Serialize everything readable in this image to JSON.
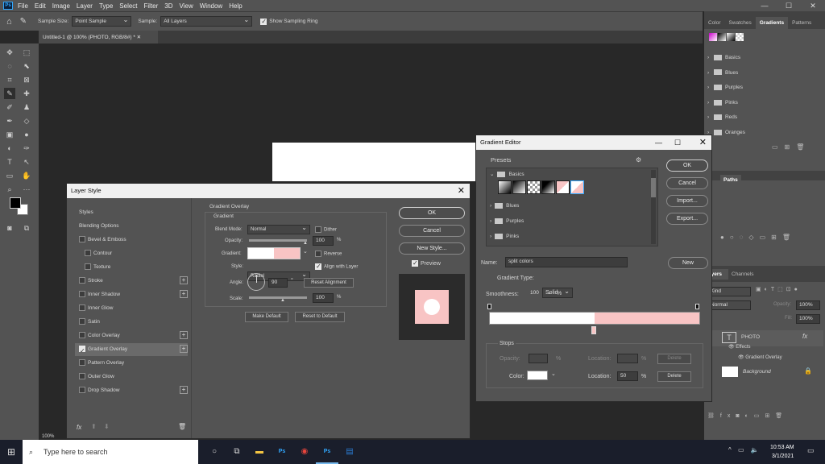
{
  "menu": {
    "items": [
      "File",
      "Edit",
      "Image",
      "Layer",
      "Type",
      "Select",
      "Filter",
      "3D",
      "View",
      "Window",
      "Help"
    ],
    "ps": "Ps"
  },
  "options": {
    "sample_size_label": "Sample Size:",
    "sample_size_value": "Point Sample",
    "sample_label": "Sample:",
    "sample_value": "All Layers",
    "show_ring": "Show Sampling Ring"
  },
  "document": {
    "tab": "Untitled-1 @ 100% (PHOTO, RGB/8#) *",
    "zoom": "100%"
  },
  "right_panel": {
    "tabs": [
      "Color",
      "Swatches",
      "Gradients",
      "Patterns"
    ],
    "folders": [
      "Basics",
      "Blues",
      "Purples",
      "Pinks",
      "Reds",
      "Oranges"
    ],
    "paths_tab": "Paths",
    "layers_tabs": [
      "Layers",
      "Channels"
    ],
    "kind": "Kind",
    "blend": "Normal",
    "opacity_label": "Opacity:",
    "opacity": "100%",
    "fill_label": "Fill:",
    "fill": "100%",
    "layers": [
      {
        "name": "PHOTO"
      },
      {
        "name": "Effects"
      },
      {
        "name": "Gradient Overlay"
      },
      {
        "name": "Background"
      }
    ],
    "fx": "fx"
  },
  "layer_style": {
    "title": "Layer Style",
    "items": [
      "Styles",
      "Blending Options",
      "Bevel & Emboss",
      "Contour",
      "Texture",
      "Stroke",
      "Inner Shadow",
      "Inner Glow",
      "Satin",
      "Color Overlay",
      "Gradient Overlay",
      "Pattern Overlay",
      "Outer Glow",
      "Drop Shadow"
    ],
    "section_title": "Gradient Overlay",
    "group_title": "Gradient",
    "blend_mode_label": "Blend Mode:",
    "blend_mode": "Normal",
    "dither": "Dither",
    "opacity_label": "Opacity:",
    "opacity": "100",
    "pct": "%",
    "gradient_label": "Gradient:",
    "reverse": "Reverse",
    "style_label": "Style:",
    "style": "Radial",
    "align": "Align with Layer",
    "angle_label": "Angle:",
    "angle": "90",
    "deg": "°",
    "reset_alignment": "Reset Alignment",
    "scale_label": "Scale:",
    "scale": "100",
    "make_default": "Make Default",
    "reset_default": "Reset to Default",
    "ok": "OK",
    "cancel": "Cancel",
    "new_style": "New Style...",
    "preview": "Preview",
    "fx": "fx"
  },
  "gradient_editor": {
    "title": "Gradient Editor",
    "presets": "Presets",
    "folders": [
      "Basics",
      "Blues",
      "Purples",
      "Pinks"
    ],
    "ok": "OK",
    "cancel": "Cancel",
    "import": "Import...",
    "export": "Export...",
    "name_label": "Name:",
    "name": "split colors",
    "new": "New",
    "type_label": "Gradient Type:",
    "type": "Solid",
    "smooth_label": "Smoothness:",
    "smooth": "100",
    "pct": "%",
    "stops": "Stops",
    "opacity_label": "Opacity:",
    "location_label": "Location:",
    "delete": "Delete",
    "color_label": "Color:",
    "location": "50"
  },
  "taskbar": {
    "search": "Type here to search",
    "time": "10:53 AM",
    "date": "3/1/2021",
    "ps1": "Ps",
    "ps2": "Ps"
  },
  "colors": {
    "pink": "#f8c4c4",
    "accent": "#31a8ff"
  }
}
